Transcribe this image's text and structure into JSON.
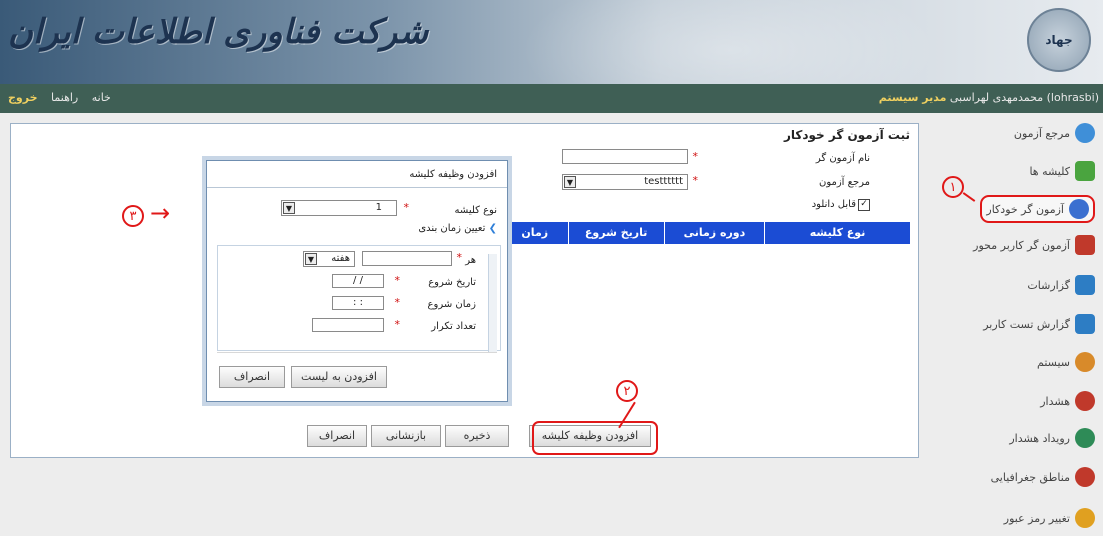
{
  "banner": {
    "title": "شرکت فناوری اطلاعات ایران",
    "logo_text": "جهاد"
  },
  "nav": {
    "user_text": "(lohrasbi) محمدمهدی لهراسبی",
    "role": "مدیر سیستم",
    "links": [
      "خانه",
      "راهنما"
    ],
    "logout": "خروج"
  },
  "sidebar": {
    "items": [
      {
        "label": "مرجع آزمون",
        "icon": "globe-icon",
        "color": "#3f8fd8"
      },
      {
        "label": "کلیشه ها",
        "icon": "chart-icon",
        "color": "#4aa43f"
      },
      {
        "label": "آزمون گر خودکار",
        "icon": "disk-icon",
        "color": "#3a6fd0"
      },
      {
        "label": "آزمون گر کاربر محور",
        "icon": "network-icon",
        "color": "#c0392b"
      },
      {
        "label": "گزارشات",
        "icon": "report-icon",
        "color": "#2d7dc4"
      },
      {
        "label": "گزارش تست کاربر",
        "icon": "report-icon",
        "color": "#2d7dc4"
      },
      {
        "label": "سیستم",
        "icon": "users-icon",
        "color": "#d88a2a"
      },
      {
        "label": "هشدار",
        "icon": "clock-icon",
        "color": "#c0392b"
      },
      {
        "label": "رویداد هشدار",
        "icon": "event-icon",
        "color": "#2e8b57"
      },
      {
        "label": "مناطق جغرافیایی",
        "icon": "heart-globe-icon",
        "color": "#c0392b"
      },
      {
        "label": "تغییر رمز عبور",
        "icon": "user-key-icon",
        "color": "#e0a020"
      }
    ]
  },
  "form": {
    "title": "ثبت آزمون گر خودکار",
    "name_label": "نام آزمون گر",
    "name_value": "",
    "ref_label": "مرجع آزمون",
    "ref_value": "testttttt",
    "download_label": "قابل دانلود",
    "download_checked": true
  },
  "grid": {
    "columns": [
      "نوع کلیشه",
      "دوره زمانی",
      "تاریخ شروع",
      "زمان"
    ]
  },
  "buttons": {
    "add_template": "افزودن وظیفه کلیشه",
    "save": "ذخیره",
    "reset": "بازنشانی",
    "cancel": "انصراف"
  },
  "dialog": {
    "title": "افزودن وظیفه کلیشه",
    "type_label": "نوع کلیشه",
    "type_value": "1",
    "schedule_title": "تعیین زمان بندی",
    "every_label": "هر",
    "every_value": "",
    "every_unit": "هفته",
    "start_date_label": "تاریخ شروع",
    "start_date_value": "/ /",
    "start_time_label": "زمان شروع",
    "start_time_value": ": :",
    "repeat_label": "تعداد تکرار",
    "repeat_value": "",
    "add_button": "افزودن به لیست",
    "cancel_button": "انصراف"
  },
  "callouts": {
    "one": "۱",
    "two": "۲",
    "three": "۳",
    "arrow": "→"
  },
  "required_mark": "*"
}
